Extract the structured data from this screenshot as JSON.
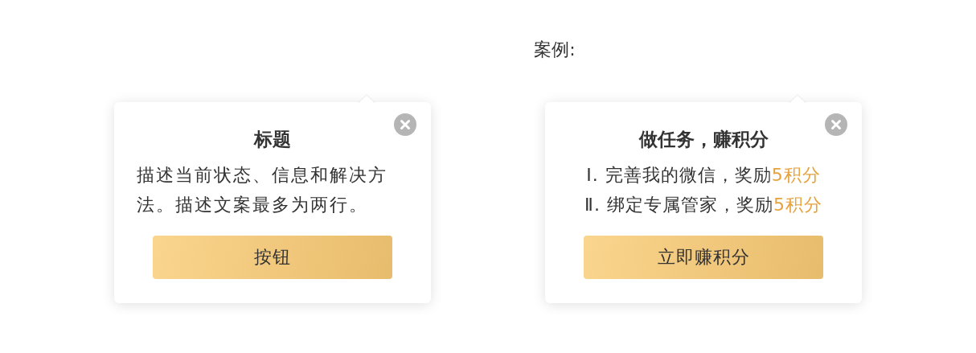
{
  "caption": "案例:",
  "popovers": [
    {
      "kind": "paragraph",
      "title": "标题",
      "body": "描述当前状态、信息和解决方法。描述文案最多为两行。",
      "button": "按钮"
    },
    {
      "kind": "list",
      "title": "做任务，赚积分",
      "lines": [
        {
          "text": "Ⅰ. 完善我的微信，奖励",
          "reward": "5积分"
        },
        {
          "text": "Ⅱ. 绑定专属管家，奖励",
          "reward": "5积分"
        }
      ],
      "button": "立即赚积分"
    }
  ]
}
